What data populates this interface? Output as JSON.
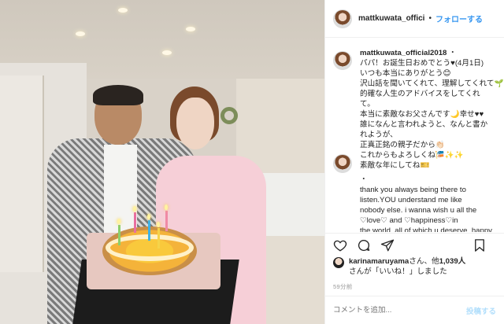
{
  "header": {
    "username": "mattkuwata_offici",
    "separator": "•",
    "follow_label": "フォローする"
  },
  "caption": {
    "username": "mattkuwata_official2018",
    "separator": "・",
    "lines": [
      "パパ！お誕生日おめでとう♥(4月1日)",
      "いつも本当にありがとう😊",
      "沢山話を聞いてくれて、理解してくれて🌱",
      "的確な人生のアドバイスをしてくれ",
      "て。",
      "本当に素敵なお父さんです🌙幸せ♥♥",
      "誰になんと言われようと、なんと書か",
      "れようが、",
      "正真正銘の親子だから👏🏻",
      "これからもよろしくね🎏✨✨",
      "素敵な年にしてね🎫"
    ]
  },
  "comment2": {
    "lines": [
      "・",
      "thank you always being there to",
      "listen.YOU understand me like",
      "nobody else. i wanna wish u all the",
      "♡love♡ and ♡happiness♡in",
      "the world. all of which u deserve. happy"
    ]
  },
  "likes": {
    "liker": "karinamaruyama",
    "text_mid": "さん、他",
    "count": "1,039人",
    "text_end": "さんが「いいね！」しました"
  },
  "timestamp": "59分前",
  "comment_box": {
    "placeholder": "コメントを追加...",
    "post_label": "投稿する"
  },
  "icons": {
    "like": "heart-icon",
    "comment": "comment-icon",
    "share": "share-icon",
    "save": "bookmark-icon"
  }
}
